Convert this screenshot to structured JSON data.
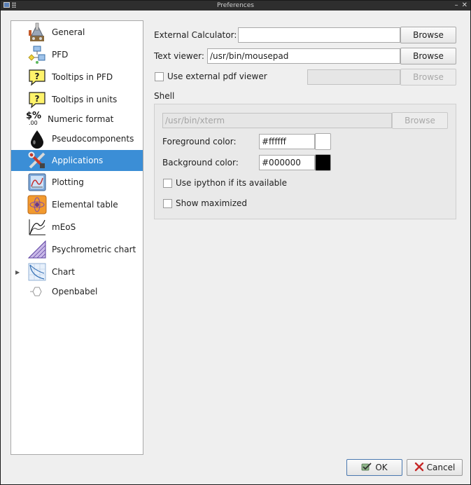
{
  "window": {
    "title": "Preferences",
    "controls": {
      "minimize": "–",
      "close": "✕"
    }
  },
  "sidebar": {
    "items": [
      {
        "label": "General",
        "icon": "general-icon"
      },
      {
        "label": "PFD",
        "icon": "pfd-icon"
      },
      {
        "label": "Tooltips in PFD",
        "icon": "tooltip-icon"
      },
      {
        "label": "Tooltips in units",
        "icon": "tooltip-icon"
      },
      {
        "label": "Numeric format",
        "icon": "numeric-format-icon",
        "icon_text": "$%",
        "icon_subtext": ".00"
      },
      {
        "label": "Pseudocomponents",
        "icon": "drop-icon"
      },
      {
        "label": "Applications",
        "icon": "applications-icon",
        "selected": true
      },
      {
        "label": "Plotting",
        "icon": "plotting-icon"
      },
      {
        "label": "Elemental table",
        "icon": "elemental-table-icon"
      },
      {
        "label": "mEoS",
        "icon": "meos-icon"
      },
      {
        "label": "Psychrometric chart",
        "icon": "psychrometric-icon"
      },
      {
        "label": "Chart",
        "icon": "chart-icon",
        "expandable": true
      },
      {
        "label": "Openbabel",
        "icon": "openbabel-icon"
      }
    ]
  },
  "applications": {
    "external_calculator": {
      "label": "External Calculator:",
      "value": "",
      "browse": "Browse"
    },
    "text_viewer": {
      "label": "Text viewer:",
      "value": "/usr/bin/mousepad",
      "browse": "Browse"
    },
    "pdf_viewer": {
      "label": "Use external pdf viewer",
      "checked": false,
      "value": "",
      "browse": "Browse"
    },
    "shell": {
      "title": "Shell",
      "path": "/usr/bin/xterm",
      "browse": "Browse",
      "foreground": {
        "label": "Foreground color:",
        "value": "#ffffff",
        "color": "#ffffff"
      },
      "background": {
        "label": "Background color:",
        "value": "#000000",
        "color": "#000000"
      },
      "ipython": {
        "label": "Use ipython if its available",
        "checked": false
      },
      "maximized": {
        "label": "Show maximized",
        "checked": false
      }
    }
  },
  "footer": {
    "ok": "OK",
    "cancel": "Cancel"
  },
  "colors": {
    "selection": "#3b8ed6",
    "window_bg": "#efefef",
    "titlebar_bg": "#2e2e2e"
  }
}
